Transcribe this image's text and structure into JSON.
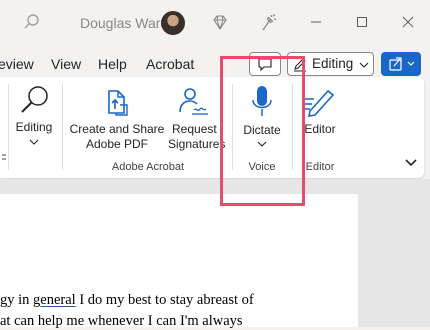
{
  "titlebar": {
    "user_name": "Douglas Ware"
  },
  "menu": {
    "tabs": [
      "eview",
      "View",
      "Help",
      "Acrobat"
    ],
    "editing_mode": "Editing"
  },
  "ribbon": {
    "editing_label": "Editing",
    "create_share_pdf_line1": "Create and Share",
    "create_share_pdf_line2": "Adobe PDF",
    "request_signatures_line1": "Request",
    "request_signatures_line2": "Signatures",
    "dictate_label": "Dictate",
    "editor_label": "Editor",
    "groups": {
      "adobe_acrobat": "Adobe Acrobat",
      "voice": "Voice",
      "editor": "Editor"
    }
  },
  "document": {
    "line1_before": "gy in ",
    "line1_link": "general",
    "line1_after": " I do my best to stay abreast of",
    "line2": "at can help me whenever I can I'm always"
  },
  "colors": {
    "accent": "#1a66c9",
    "highlight": "#e94c6a",
    "icon_blue": "#1a66c9"
  }
}
